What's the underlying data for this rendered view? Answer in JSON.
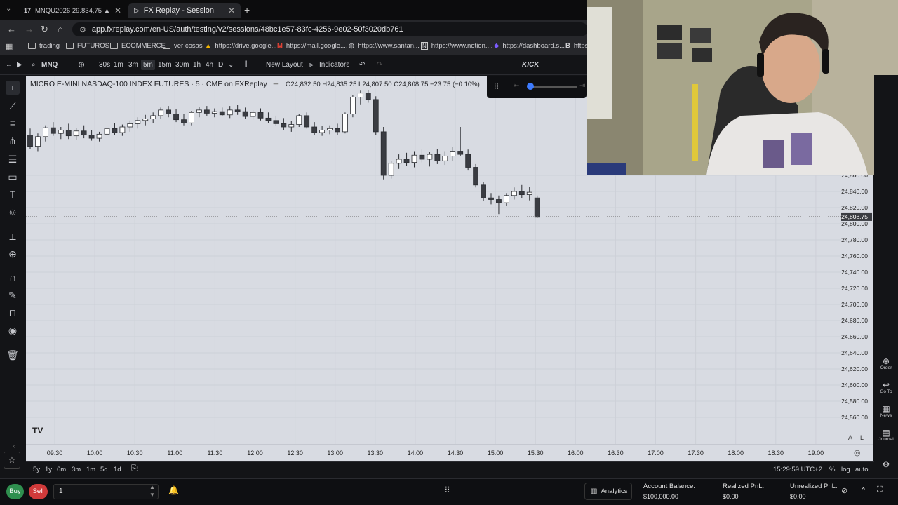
{
  "browser": {
    "tabs": [
      {
        "label": "MNQU2026 29.834,75 ▲ +1.18"
      },
      {
        "label": "FX Replay - Session"
      }
    ],
    "url": "app.fxreplay.com/en-US/auth/testing/v2/sessions/48bc1e57-83fc-4256-9e02-50f3020db761",
    "bookmarks": [
      "trading",
      "FUTUROS",
      "ECOMMERCE",
      "ver cosas",
      "https://drive.google...",
      "https://mail.google....",
      "https://www.santan...",
      "https://www.notion....",
      "https://dashboard.s...",
      "https"
    ]
  },
  "toolbar": {
    "symbol": "MNQ",
    "intervals": [
      "30s",
      "1m",
      "3m",
      "5m",
      "15m",
      "30m",
      "1h",
      "4h",
      "D"
    ],
    "selected_interval": "5m",
    "new_layout": "New Layout",
    "indicators": "Indicators",
    "center_label": "KICK"
  },
  "chart": {
    "title": "MICRO E-MINI NASDAQ-100 INDEX FUTURES · 5 · CME on FXReplay",
    "ohlc": "O24,832.50  H24,835.25  L24,807.50  C24,808.75  −23.75  (−0.10%)",
    "current_price": "24,808.75",
    "price_labels": [
      "24,860.00",
      "24,840.00",
      "24,820.00",
      "24,800.00",
      "24,780.00",
      "24,760.00",
      "24,740.00",
      "24,720.00",
      "24,700.00",
      "24,680.00",
      "24,660.00",
      "24,640.00",
      "24,620.00",
      "24,600.00",
      "24,580.00",
      "24,560.00"
    ],
    "time_labels": [
      "09:30",
      "10:00",
      "10:30",
      "11:00",
      "11:30",
      "12:00",
      "12:30",
      "13:00",
      "13:30",
      "14:00",
      "14:30",
      "15:00",
      "15:30",
      "16:00",
      "16:30",
      "17:00",
      "17:30",
      "18:00",
      "18:30",
      "19:00"
    ],
    "scale_buttons": [
      "A",
      "L"
    ]
  },
  "chart_data": {
    "type": "candlestick",
    "unit": "price",
    "candles": [
      [
        24910,
        24918,
        24893,
        24896
      ],
      [
        24896,
        24912,
        24890,
        24908
      ],
      [
        24908,
        24922,
        24902,
        24919
      ],
      [
        24919,
        24926,
        24909,
        24912
      ],
      [
        24912,
        24920,
        24905,
        24916
      ],
      [
        24916,
        24924,
        24905,
        24909
      ],
      [
        24909,
        24919,
        24904,
        24915
      ],
      [
        24915,
        24922,
        24906,
        24910
      ],
      [
        24910,
        24916,
        24903,
        24906
      ],
      [
        24906,
        24914,
        24902,
        24911
      ],
      [
        24911,
        24921,
        24907,
        24918
      ],
      [
        24918,
        24925,
        24910,
        24913
      ],
      [
        24913,
        24923,
        24909,
        24920
      ],
      [
        24920,
        24928,
        24914,
        24924
      ],
      [
        24924,
        24932,
        24918,
        24928
      ],
      [
        24928,
        24935,
        24922,
        24930
      ],
      [
        24930,
        24938,
        24925,
        24934
      ],
      [
        24934,
        24944,
        24930,
        24941
      ],
      [
        24941,
        24946,
        24932,
        24936
      ],
      [
        24936,
        24942,
        24926,
        24929
      ],
      [
        24929,
        24936,
        24922,
        24925
      ],
      [
        24925,
        24940,
        24922,
        24938
      ],
      [
        24938,
        24945,
        24932,
        24941
      ],
      [
        24941,
        24946,
        24934,
        24937
      ],
      [
        24937,
        24943,
        24932,
        24939
      ],
      [
        24939,
        24944,
        24933,
        24935
      ],
      [
        24935,
        24946,
        24931,
        24941
      ],
      [
        24941,
        24947,
        24935,
        24939
      ],
      [
        24939,
        24944,
        24930,
        24933
      ],
      [
        24933,
        24941,
        24929,
        24938
      ],
      [
        24938,
        24943,
        24928,
        24931
      ],
      [
        24931,
        24938,
        24925,
        24928
      ],
      [
        24928,
        24934,
        24921,
        24924
      ],
      [
        24924,
        24931,
        24916,
        24920
      ],
      [
        24920,
        24927,
        24914,
        24923
      ],
      [
        24923,
        24936,
        24920,
        24934
      ],
      [
        24934,
        24938,
        24918,
        24920
      ],
      [
        24920,
        24926,
        24910,
        24913
      ],
      [
        24913,
        24921,
        24909,
        24916
      ],
      [
        24916,
        24922,
        24911,
        24918
      ],
      [
        24918,
        24924,
        24910,
        24914
      ],
      [
        24914,
        24938,
        24912,
        24936
      ],
      [
        24936,
        24960,
        24932,
        24957
      ],
      [
        24957,
        24965,
        24948,
        24962
      ],
      [
        24962,
        24966,
        24950,
        24954
      ],
      [
        24954,
        24958,
        24910,
        24914
      ],
      [
        24914,
        24920,
        24855,
        24860
      ],
      [
        24860,
        24878,
        24856,
        24875
      ],
      [
        24875,
        24886,
        24868,
        24880
      ],
      [
        24880,
        24888,
        24872,
        24876
      ],
      [
        24876,
        24890,
        24870,
        24885
      ],
      [
        24885,
        24892,
        24876,
        24880
      ],
      [
        24880,
        24889,
        24871,
        24886
      ],
      [
        24886,
        24893,
        24874,
        24878
      ],
      [
        24878,
        24890,
        24873,
        24884
      ],
      [
        24884,
        24895,
        24878,
        24890
      ],
      [
        24890,
        24920,
        24884,
        24886
      ],
      [
        24886,
        24892,
        24866,
        24870
      ],
      [
        24870,
        24874,
        24845,
        24848
      ],
      [
        24848,
        24852,
        24828,
        24832
      ],
      [
        24832,
        24838,
        24824,
        24830
      ],
      [
        24830,
        24835,
        24812,
        24826
      ],
      [
        24826,
        24838,
        24822,
        24835
      ],
      [
        24835,
        24845,
        24830,
        24840
      ],
      [
        24840,
        24848,
        24832,
        24836
      ],
      [
        24836,
        24846,
        24829,
        24839
      ],
      [
        24832,
        24835,
        24807,
        24808
      ]
    ]
  },
  "range_buttons": [
    "5y",
    "1y",
    "6m",
    "3m",
    "1m",
    "5d",
    "1d"
  ],
  "clock": "15:29:59 UTC+2",
  "bottom_right_toggles": [
    "%",
    "log",
    "auto"
  ],
  "right_panel": [
    "Order",
    "Go To",
    "News",
    "Journal"
  ],
  "order_bar": {
    "buy": "Buy",
    "sell": "Sell",
    "quantity": "1",
    "analytics": "Analytics",
    "account_balance_label": "Account Balance:",
    "account_balance": "$100,000.00",
    "realized_label": "Realized PnL:",
    "realized": "$0.00",
    "unrealized_label": "Unrealized PnL:",
    "unrealized": "$0.00"
  },
  "colors": {
    "up_candle": "#ffffff",
    "down_candle": "#3a3c42",
    "chart_bg": "#d8dbe2",
    "buy": "#2f8f4f",
    "sell": "#d03a3a"
  }
}
